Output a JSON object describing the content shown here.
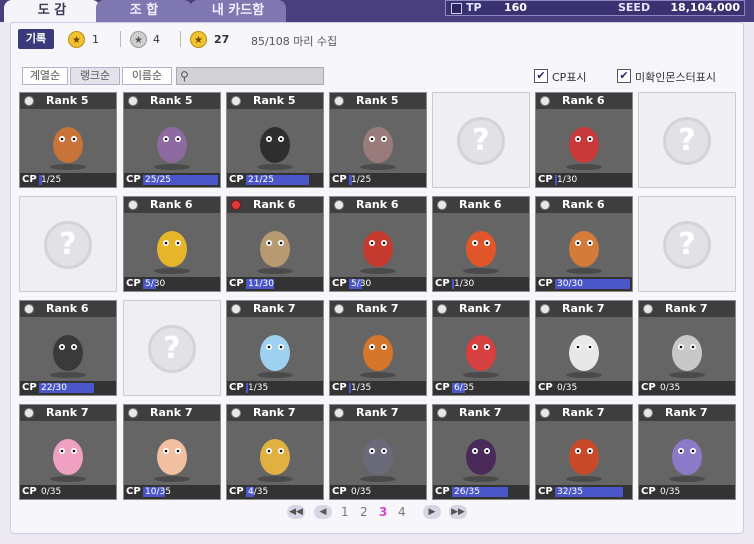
{
  "tabs": [
    {
      "label": "도 감",
      "active": true
    },
    {
      "label": "조 합",
      "active": false
    },
    {
      "label": "내 카드함",
      "active": false
    }
  ],
  "status": {
    "tp_label": "TP",
    "tp_value": "160",
    "seed_label": "SEED",
    "seed_value": "18,104,000"
  },
  "header": {
    "record_button": "기록",
    "gold_count": "1",
    "silver_count": "4",
    "total_count": "27",
    "collect_text": "85/108 마리 수집"
  },
  "sort": {
    "buttons": [
      "계열순",
      "랭크순",
      "이름순"
    ],
    "active": "랭크순",
    "search_placeholder": ""
  },
  "options": {
    "cp_label": "CP표시",
    "cp_checked": true,
    "unknown_label": "미확인몬스터표시",
    "unknown_checked": true
  },
  "colors": {
    "cp_bar": "#4b57c9",
    "card_bg": "#656565",
    "current_page": "#d04ad0"
  },
  "cards": [
    {
      "rank": "Rank 5",
      "cp": "1/25",
      "fill": 0.04,
      "art": "#c8733a"
    },
    {
      "rank": "Rank 5",
      "cp": "25/25",
      "fill": 1.0,
      "art": "#8c6a9f"
    },
    {
      "rank": "Rank 5",
      "cp": "21/25",
      "fill": 0.84,
      "art": "#2e2e2e"
    },
    {
      "rank": "Rank 5",
      "cp": "1/25",
      "fill": 0.04,
      "art": "#9a7b7b"
    },
    {
      "empty": true
    },
    {
      "rank": "Rank 6",
      "cp": "1/30",
      "fill": 0.03,
      "art": "#c83a3a"
    },
    {
      "empty": true
    },
    {
      "empty": true
    },
    {
      "rank": "Rank 6",
      "cp": "5/30",
      "fill": 0.17,
      "art": "#e6b52a"
    },
    {
      "rank": "Rank 6",
      "cp": "11/30",
      "fill": 0.37,
      "art": "#b89a72",
      "heart": true
    },
    {
      "rank": "Rank 6",
      "cp": "5/30",
      "fill": 0.17,
      "art": "#c43a2e"
    },
    {
      "rank": "Rank 6",
      "cp": "1/30",
      "fill": 0.03,
      "art": "#e0552a"
    },
    {
      "rank": "Rank 6",
      "cp": "30/30",
      "fill": 1.0,
      "art": "#d47a3a"
    },
    {
      "empty": true
    },
    {
      "rank": "Rank 6",
      "cp": "22/30",
      "fill": 0.73,
      "art": "#3a3a3a"
    },
    {
      "empty": true
    },
    {
      "rank": "Rank 7",
      "cp": "1/35",
      "fill": 0.03,
      "art": "#9fd2f0"
    },
    {
      "rank": "Rank 7",
      "cp": "1/35",
      "fill": 0.03,
      "art": "#d6762a"
    },
    {
      "rank": "Rank 7",
      "cp": "6/35",
      "fill": 0.17,
      "art": "#d64040"
    },
    {
      "rank": "Rank 7",
      "cp": "0/35",
      "fill": 0,
      "art": "#e8e8e8"
    },
    {
      "rank": "Rank 7",
      "cp": "0/35",
      "fill": 0,
      "art": "#c8c8c8"
    },
    {
      "rank": "Rank 7",
      "cp": "0/35",
      "fill": 0,
      "art": "#f0a0c0"
    },
    {
      "rank": "Rank 7",
      "cp": "10/35",
      "fill": 0.29,
      "art": "#f0c0a0"
    },
    {
      "rank": "Rank 7",
      "cp": "4/35",
      "fill": 0.11,
      "art": "#e0b040"
    },
    {
      "rank": "Rank 7",
      "cp": "0/35",
      "fill": 0,
      "art": "#6a6a7a"
    },
    {
      "rank": "Rank 7",
      "cp": "26/35",
      "fill": 0.74,
      "art": "#4a2a5a"
    },
    {
      "rank": "Rank 7",
      "cp": "32/35",
      "fill": 0.91,
      "art": "#c84a2a"
    },
    {
      "rank": "Rank 7",
      "cp": "0/35",
      "fill": 0,
      "art": "#8a7ac8"
    }
  ],
  "pagination": {
    "pages": [
      "1",
      "2",
      "3",
      "4"
    ],
    "current": "3",
    "first_icon": "double-left-icon",
    "prev_icon": "left-icon",
    "next_icon": "right-icon",
    "last_icon": "double-right-icon"
  }
}
